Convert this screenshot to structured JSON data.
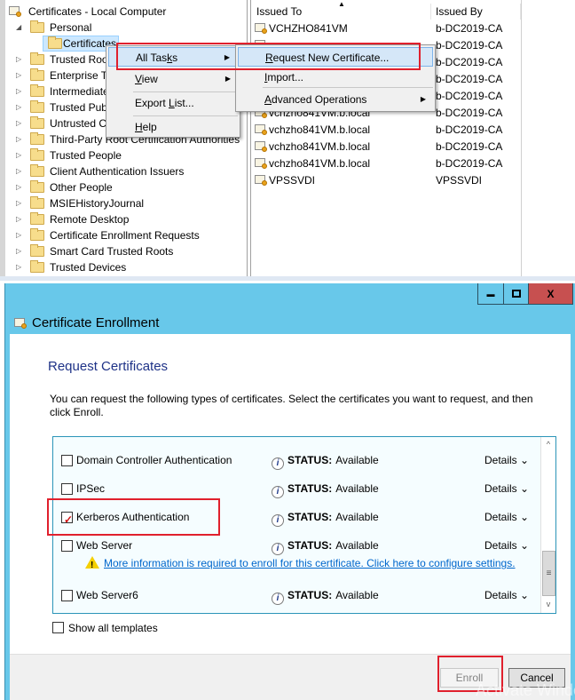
{
  "mmc": {
    "tree": {
      "root": "Certificates - Local Computer",
      "items": [
        {
          "label": "Personal",
          "expanded": true
        },
        {
          "label": "Certificates",
          "selected": true
        },
        {
          "label": "Trusted Root Certification Authorities"
        },
        {
          "label": "Enterprise Trust"
        },
        {
          "label": "Intermediate Certification Authorities"
        },
        {
          "label": "Trusted Publishers"
        },
        {
          "label": "Untrusted Certificates"
        },
        {
          "label": "Third-Party Root Certification Authorities"
        },
        {
          "label": "Trusted People"
        },
        {
          "label": "Client Authentication Issuers"
        },
        {
          "label": "Other People"
        },
        {
          "label": "MSIEHistoryJournal"
        },
        {
          "label": "Remote Desktop"
        },
        {
          "label": "Certificate Enrollment Requests"
        },
        {
          "label": "Smart Card Trusted Roots"
        },
        {
          "label": "Trusted Devices"
        }
      ]
    },
    "list": {
      "columns": [
        "Issued To",
        "Issued By"
      ],
      "sort_indicator": "▲",
      "rows": [
        {
          "issued_to": "VCHZHO841VM",
          "issued_by": "b-DC2019-CA"
        },
        {
          "issued_to": "",
          "issued_by": "b-DC2019-CA"
        },
        {
          "issued_to": "",
          "issued_by": "b-DC2019-CA"
        },
        {
          "issued_to": "",
          "issued_by": "b-DC2019-CA"
        },
        {
          "issued_to": "",
          "issued_by": "b-DC2019-CA"
        },
        {
          "issued_to": "vchzho841VM.b.local",
          "issued_by": "b-DC2019-CA"
        },
        {
          "issued_to": "vchzho841VM.b.local",
          "issued_by": "b-DC2019-CA"
        },
        {
          "issued_to": "vchzho841VM.b.local",
          "issued_by": "b-DC2019-CA"
        },
        {
          "issued_to": "vchzho841VM.b.local",
          "issued_by": "b-DC2019-CA"
        },
        {
          "issued_to": "VPSSVDI",
          "issued_by": "VPSSVDI"
        }
      ]
    },
    "context_menu": {
      "items": [
        {
          "pre": "All Tas",
          "key": "k",
          "post": "s",
          "submenu": true,
          "highlighted": true
        },
        {
          "pre": "",
          "key": "V",
          "post": "iew",
          "submenu": true
        },
        {
          "pre": "Export ",
          "key": "L",
          "post": "ist..."
        },
        {
          "pre": "",
          "key": "H",
          "post": "elp"
        }
      ]
    },
    "submenu": {
      "items": [
        {
          "pre": "",
          "key": "R",
          "post": "equest New Certificate...",
          "highlighted": true
        },
        {
          "pre": "",
          "key": "I",
          "post": "mport..."
        },
        {
          "pre": "",
          "key": "A",
          "post": "dvanced Operations",
          "submenu": true
        }
      ]
    }
  },
  "dialog": {
    "window_buttons": {
      "minimize": "▬",
      "maximize": "□",
      "close": "X"
    },
    "title": "Certificate Enrollment",
    "heading": "Request Certificates",
    "description": "You can request the following types of certificates. Select the certificates you want to request, and then click Enroll.",
    "status_label": "STATUS:",
    "details_label": "Details ⌄",
    "certificates": [
      {
        "name": "Domain Controller Authentication",
        "status": "Available",
        "checked": false
      },
      {
        "name": "IPSec",
        "status": "Available",
        "checked": false
      },
      {
        "name": "Kerberos Authentication",
        "status": "Available",
        "checked": true
      },
      {
        "name": "Web Server",
        "status": "Available",
        "checked": false,
        "warning": "More information is required to enroll for this certificate. Click here to configure settings."
      },
      {
        "name": "Web Server6",
        "status": "Available",
        "checked": false
      }
    ],
    "scroll": {
      "up": "^",
      "down": "v",
      "grip": "≡"
    },
    "show_all_templates": {
      "label": "Show all templates",
      "checked": false
    },
    "buttons": {
      "enroll": "Enroll",
      "cancel": "Cancel"
    },
    "watermark": "Activate Windows"
  }
}
